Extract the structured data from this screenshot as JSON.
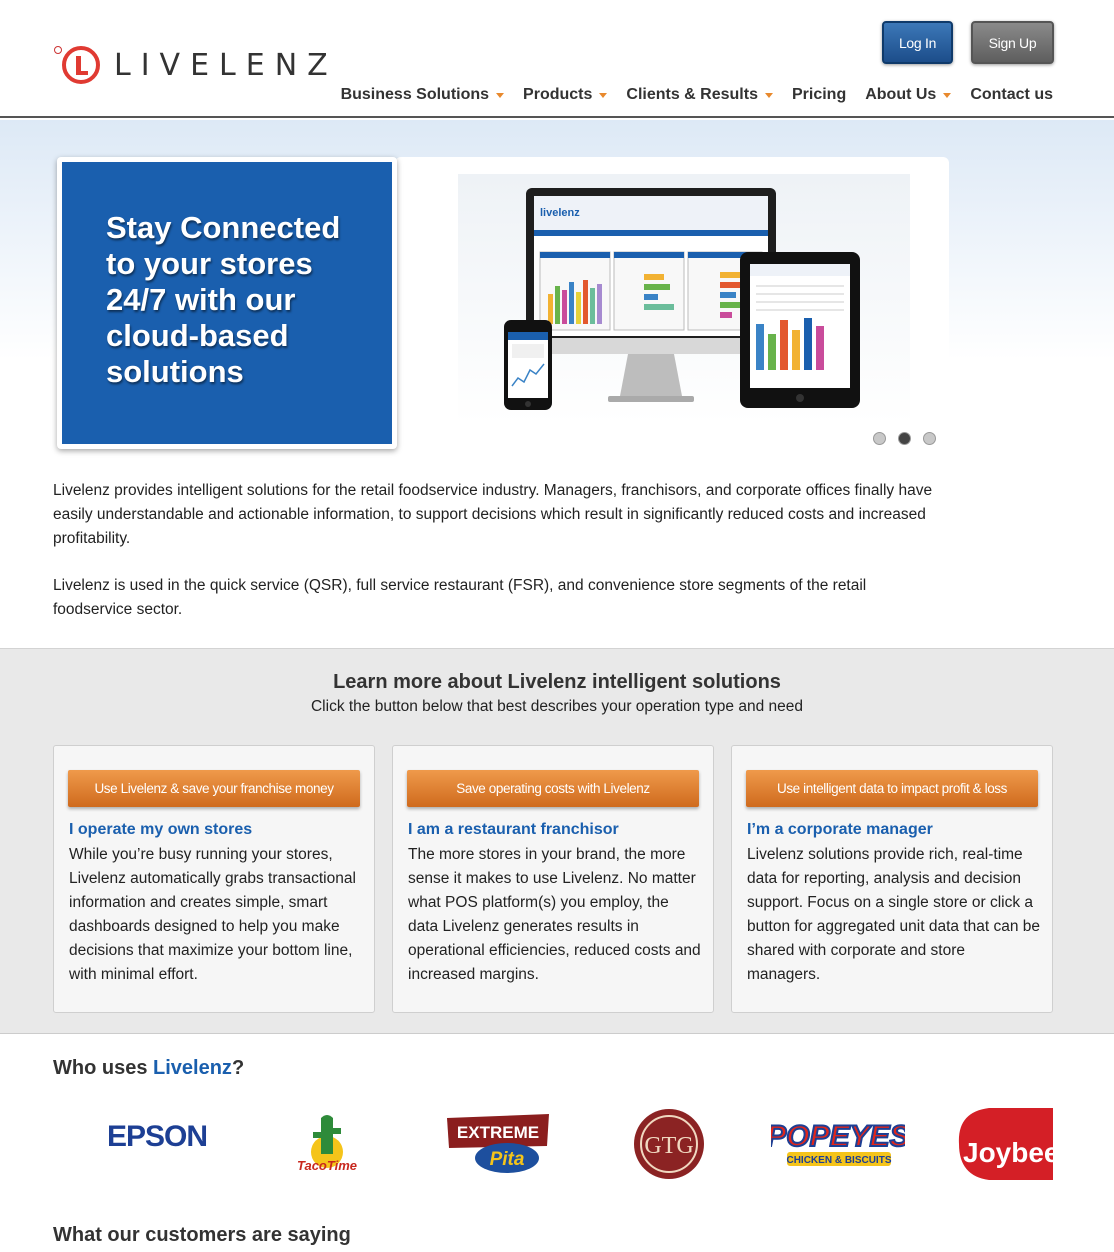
{
  "brand": {
    "name": "LIVELENZ",
    "accent": "#e03a32",
    "primary": "#1a5fae",
    "orange": "#e8892d"
  },
  "auth": {
    "login_label": "Log In",
    "signup_label": "Sign Up"
  },
  "nav": {
    "items": [
      {
        "label": "Business Solutions",
        "dropdown": true
      },
      {
        "label": "Products",
        "dropdown": true
      },
      {
        "label": "Clients & Results",
        "dropdown": true
      },
      {
        "label": "Pricing",
        "dropdown": false
      },
      {
        "label": "About Us",
        "dropdown": true
      },
      {
        "label": "Contact us",
        "dropdown": false
      }
    ]
  },
  "hero": {
    "headline": "Stay Connected to your stores 24/7 with our cloud-based solutions",
    "image_icon": "devices-dashboard-image",
    "slides": 3,
    "active_slide": 2,
    "paragraph1": "Livelenz provides intelligent solutions for the retail foodservice industry. Managers, franchisors, and corporate offices finally have easily understandable and actionable information, to support decisions which result in significantly reduced costs and increased profitability.",
    "paragraph2": "Livelenz is used in the quick service (QSR), full service restaurant (FSR), and convenience store segments of the retail foodservice sector."
  },
  "learn": {
    "title": "Learn more about Livelenz intelligent solutions",
    "subtitle": "Click the button below that best describes your operation type and need",
    "cards": [
      {
        "button": "Use Livelenz & save your franchise money",
        "heading": "I operate my own stores",
        "body": "While you’re busy running your stores, Livelenz automatically grabs transactional information and creates simple, smart dashboards designed to help you make decisions that maximize your bottom line, with minimal effort."
      },
      {
        "button": "Save operating costs with Livelenz",
        "heading": "I am a restaurant franchisor",
        "body": "The more stores in your brand, the more sense it makes to use Livelenz. No matter what POS platform(s) you employ, the data Livelenz generates results in operational efficiencies, reduced costs and increased margins."
      },
      {
        "button": "Use intelligent data to impact profit & loss",
        "heading": "I’m a corporate manager",
        "body": "Livelenz solutions provide rich, real-time data for reporting, analysis and decision support. Focus on a single store or click a button for aggregated unit data that can be shared with corporate and store managers."
      }
    ]
  },
  "who": {
    "prefix": "Who uses ",
    "brand": "Livelenz",
    "suffix": "?",
    "logos": [
      "EPSON",
      "TacoTime",
      "EXTREME Pita",
      "GTG",
      "POPEYES CHICKEN & BISCUITS",
      "Joybee"
    ]
  },
  "testimonials": {
    "title": "What our customers are saying"
  }
}
